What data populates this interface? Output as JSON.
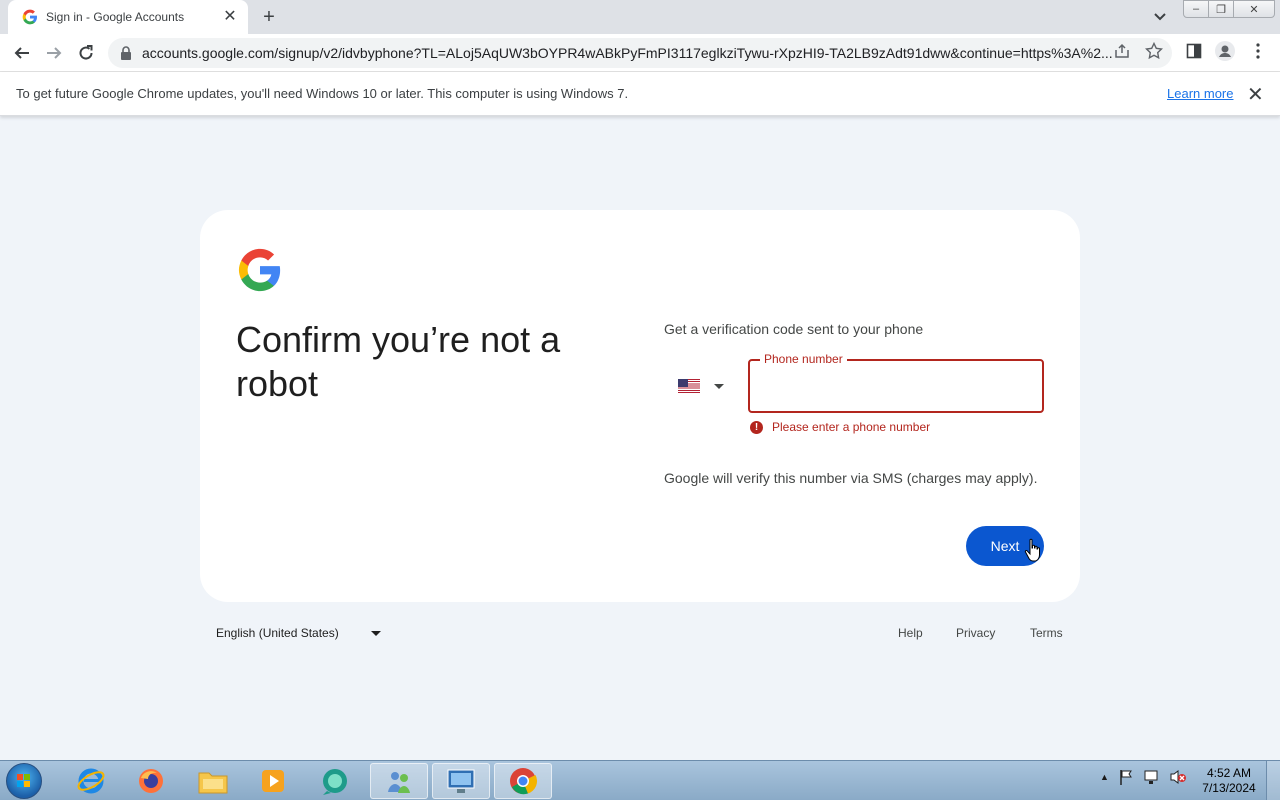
{
  "browser": {
    "tab_title": "Sign in - Google Accounts",
    "url": "accounts.google.com/signup/v2/idvbyphone?TL=ALoj5AqUW3bOYPR4wABkPyFmPI3117eglkziTywu-rXpzHI9-TA2LB9zAdt91dww&continue=https%3A%2...",
    "infobar_message": "To get future Google Chrome updates, you'll need Windows 10 or later. This computer is using Windows 7.",
    "infobar_link": "Learn more"
  },
  "page": {
    "heading": "Confirm you’re not a robot",
    "subtitle": "Get a verification code sent to your phone",
    "country_flag": "us-flag-icon",
    "phone_label": "Phone number",
    "phone_value": "",
    "error_text": "Please enter a phone number",
    "verify_note": "Google will verify this number via SMS (charges may apply).",
    "next_label": "Next",
    "error_color": "#b3261e",
    "button_color": "#0b57d0"
  },
  "footer": {
    "language": "English (United States)",
    "help": "Help",
    "privacy": "Privacy",
    "terms": "Terms"
  },
  "taskbar": {
    "time": "4:52 AM",
    "date": "7/13/2024"
  }
}
